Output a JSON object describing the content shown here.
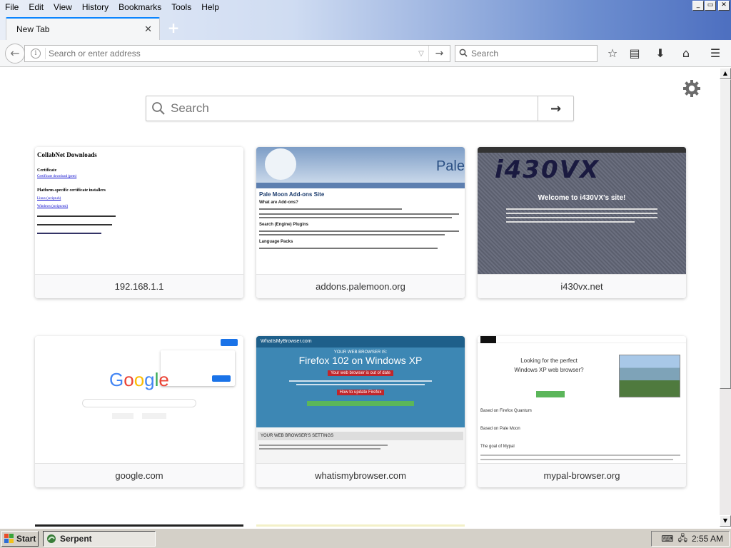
{
  "menubar": {
    "items": [
      "File",
      "Edit",
      "View",
      "History",
      "Bookmarks",
      "Tools",
      "Help"
    ]
  },
  "window_controls": {
    "minimize": "_",
    "maximize": "▭",
    "close": "✕"
  },
  "tabs": [
    {
      "title": "New Tab",
      "close": "✕"
    }
  ],
  "newtab_button": "+",
  "navbar": {
    "back_icon": "←",
    "info_icon": "i",
    "url_placeholder": "Search or enter address",
    "dropdown_icon": "▽",
    "go_icon": "→",
    "search_placeholder": "Search",
    "bookmark_icon": "☆",
    "library_icon": "▤",
    "download_icon": "⬇",
    "home_icon": "⌂",
    "menu_icon": "☰"
  },
  "newtab_page": {
    "search_placeholder": "Search",
    "go_icon": "→",
    "tiles": [
      {
        "label": "192.168.1.1",
        "thumb": "collabnet"
      },
      {
        "label": "addons.palemoon.org",
        "thumb": "palemoon"
      },
      {
        "label": "i430vx.net",
        "thumb": "i430vx"
      },
      {
        "label": "google.com",
        "thumb": "google"
      },
      {
        "label": "whatismybrowser.com",
        "thumb": "wimb"
      },
      {
        "label": "mypal-browser.org",
        "thumb": "mypal"
      }
    ],
    "thumb_text": {
      "collabnet_title": "CollabNet Downloads",
      "collabnet_cert": "Certificate",
      "collabnet_cert_link": "Certificate download (pem)",
      "collabnet_platform": "Platform-specific certificate installers",
      "collabnet_link1": "Linux (script.sh)",
      "collabnet_link2": "Windows (script.msi)",
      "palemoon_logo": "Pale",
      "palemoon_heading": "Pale Moon Add-ons Site",
      "palemoon_sub": "What are Add-ons?",
      "palemoon_sub2": "Search (Engine) Plugins",
      "palemoon_sub3": "Language Packs",
      "i430vx_logo": "i430VX",
      "i430vx_welcome": "Welcome to i430VX's site!",
      "wimb_header": "WhatIsMyBrowser.com",
      "wimb_small": "YOUR WEB BROWSER IS:",
      "wimb_big": "Firefox 102 on Windows XP",
      "wimb_warn": "Your web browser is out of date",
      "wimb_update": "How to update Firefox",
      "wimb_settings": "YOUR WEB BROWSER'S SETTINGS",
      "mypal_line1": "Looking for the perfect",
      "mypal_line2": "Windows XP web browser?",
      "mypal_q1": "Based on Firefox Quantum",
      "mypal_q2": "Based on Pale Moon",
      "mypal_q3": "The goal of Mypal",
      "google_logo": "Google"
    }
  },
  "taskbar": {
    "start_label": "Start",
    "task_label": "Serpent",
    "clock": "2:55 AM"
  },
  "colors": {
    "accent": "#0a84ff",
    "tab_bg": "#f5f6f7",
    "taskbar": "#d4d0c8"
  }
}
